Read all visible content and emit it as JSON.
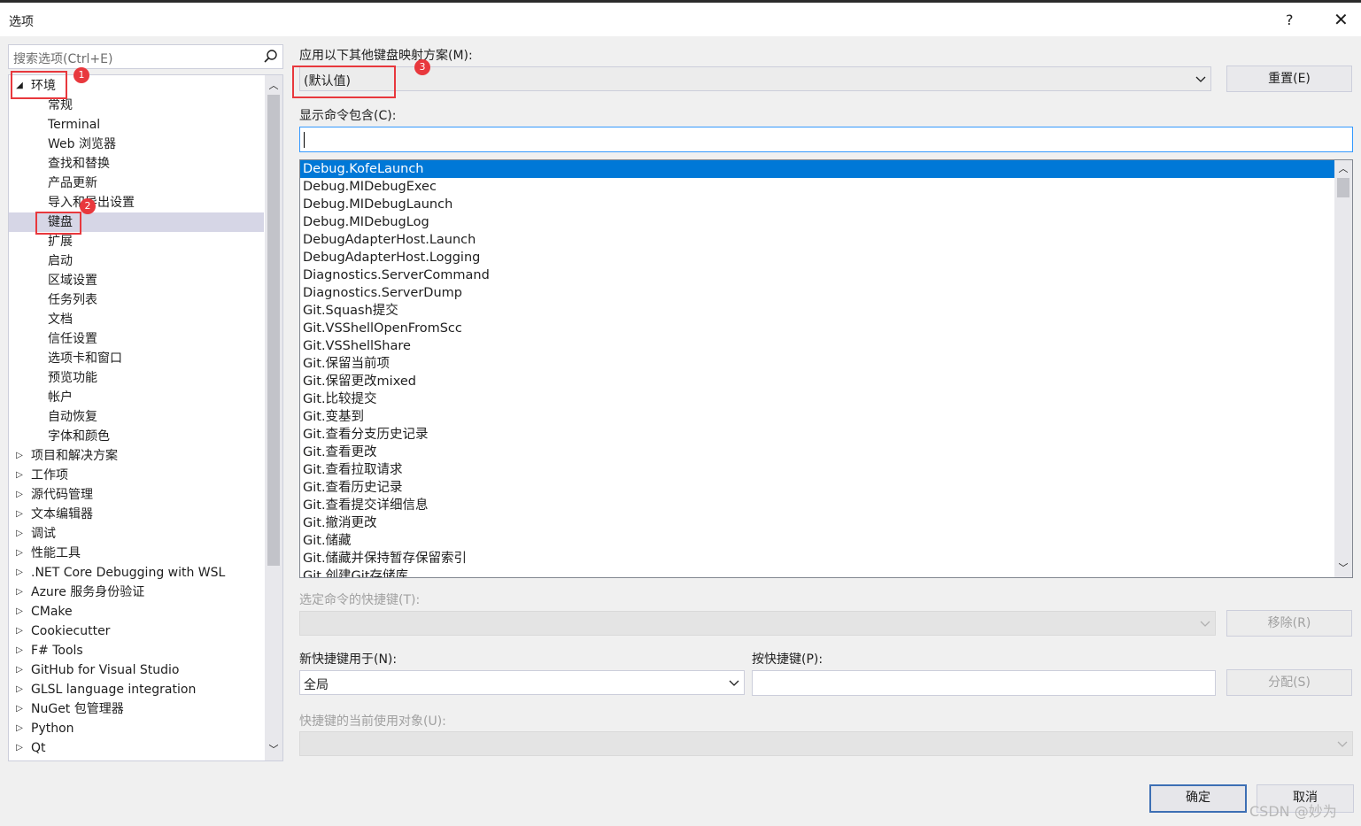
{
  "window": {
    "title": "选项",
    "help": "?",
    "close": "✕"
  },
  "search": {
    "placeholder": "搜索选项(Ctrl+E)"
  },
  "tree": {
    "items": [
      {
        "label": "环境",
        "expanded": true,
        "level": 0
      },
      {
        "label": "常规",
        "level": 1
      },
      {
        "label": "Terminal",
        "level": 1
      },
      {
        "label": "Web 浏览器",
        "level": 1
      },
      {
        "label": "查找和替换",
        "level": 1
      },
      {
        "label": "产品更新",
        "level": 1
      },
      {
        "label": "导入和导出设置",
        "level": 1
      },
      {
        "label": "键盘",
        "level": 1,
        "selected": true
      },
      {
        "label": "扩展",
        "level": 1
      },
      {
        "label": "启动",
        "level": 1
      },
      {
        "label": "区域设置",
        "level": 1
      },
      {
        "label": "任务列表",
        "level": 1
      },
      {
        "label": "文档",
        "level": 1
      },
      {
        "label": "信任设置",
        "level": 1
      },
      {
        "label": "选项卡和窗口",
        "level": 1
      },
      {
        "label": "预览功能",
        "level": 1
      },
      {
        "label": "帐户",
        "level": 1
      },
      {
        "label": "自动恢复",
        "level": 1
      },
      {
        "label": "字体和颜色",
        "level": 1
      },
      {
        "label": "项目和解决方案",
        "level": 0
      },
      {
        "label": "工作项",
        "level": 0
      },
      {
        "label": "源代码管理",
        "level": 0
      },
      {
        "label": "文本编辑器",
        "level": 0
      },
      {
        "label": "调试",
        "level": 0
      },
      {
        "label": "性能工具",
        "level": 0
      },
      {
        "label": ".NET Core Debugging with WSL",
        "level": 0
      },
      {
        "label": "Azure 服务身份验证",
        "level": 0
      },
      {
        "label": "CMake",
        "level": 0
      },
      {
        "label": "Cookiecutter",
        "level": 0
      },
      {
        "label": "F# Tools",
        "level": 0
      },
      {
        "label": "GitHub for Visual Studio",
        "level": 0
      },
      {
        "label": "GLSL language integration",
        "level": 0
      },
      {
        "label": "NuGet 包管理器",
        "level": 0
      },
      {
        "label": "Python",
        "level": 0
      },
      {
        "label": "Qt",
        "level": 0
      }
    ]
  },
  "keyboard": {
    "mapping_label": "应用以下其他键盘映射方案(M):",
    "mapping_value": "(默认值)",
    "reset_button": "重置(E)",
    "show_commands_label": "显示命令包含(C):",
    "commands": [
      "Debug.KofeLaunch",
      "Debug.MIDebugExec",
      "Debug.MIDebugLaunch",
      "Debug.MIDebugLog",
      "DebugAdapterHost.Launch",
      "DebugAdapterHost.Logging",
      "Diagnostics.ServerCommand",
      "Diagnostics.ServerDump",
      "Git.Squash提交",
      "Git.VSShellOpenFromScc",
      "Git.VSShellShare",
      "Git.保留当前项",
      "Git.保留更改mixed",
      "Git.比较提交",
      "Git.变基到",
      "Git.查看分支历史记录",
      "Git.查看更改",
      "Git.查看拉取请求",
      "Git.查看历史记录",
      "Git.查看提交详细信息",
      "Git.撤消更改",
      "Git.储藏",
      "Git.储藏并保持暂存保留索引",
      "Git.创建Git存储库"
    ],
    "selected_shortcuts_label": "选定命令的快捷键(T):",
    "remove_button": "移除(R)",
    "new_shortcut_label": "新快捷键用于(N):",
    "new_shortcut_value": "全局",
    "press_shortcut_label": "按快捷键(P):",
    "assign_button": "分配(S)",
    "current_use_label": "快捷键的当前使用对象(U):"
  },
  "footer": {
    "ok_button": "确定",
    "cancel_button": "取消"
  },
  "annotations": [
    "1",
    "2",
    "3"
  ],
  "watermark": "CSDN @妙为",
  "colors": {
    "accent": "#0078d7",
    "marker": "#e8383d"
  }
}
